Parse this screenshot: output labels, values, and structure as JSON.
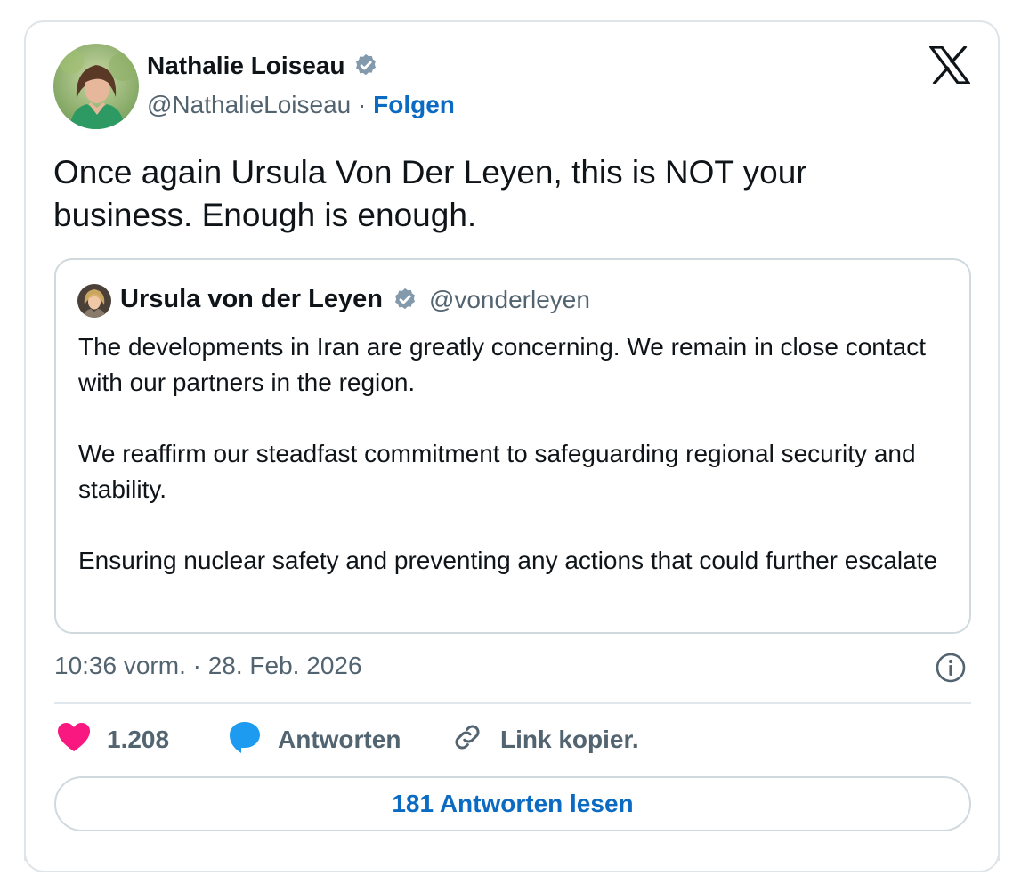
{
  "author": {
    "name": "Nathalie Loiseau",
    "handle": "@NathalieLoiseau",
    "separator": "·",
    "follow_label": "Folgen",
    "verified_icon": "verified-badge-icon"
  },
  "platform_icon": "x-logo-icon",
  "tweet": {
    "text": "Once again Ursula Von Der Leyen, this is NOT your business. Enough is enough."
  },
  "quoted": {
    "name": "Ursula von der Leyen",
    "handle": "@vonderleyen",
    "paragraphs": [
      "The developments in Iran are greatly concerning. We remain in close contact with our partners in the region.",
      "We reaffirm our steadfast commitment to safeguarding regional security and stability.",
      "Ensuring nuclear safety and preventing any actions that could further escalate"
    ]
  },
  "meta": {
    "timestamp": "10:36 vorm. · 28. Feb. 2026",
    "info_icon": "info-icon"
  },
  "actions": {
    "likes_count": "1.208",
    "reply_label": "Antworten",
    "copy_link_label": "Link kopier."
  },
  "read_replies_label": "181 Antworten lesen",
  "colors": {
    "accent": "#0b6bc2",
    "like": "#f91880",
    "reply": "#1d9bf0",
    "verified": "#829aab",
    "muted_text": "#536471",
    "border": "#cfd9de"
  }
}
